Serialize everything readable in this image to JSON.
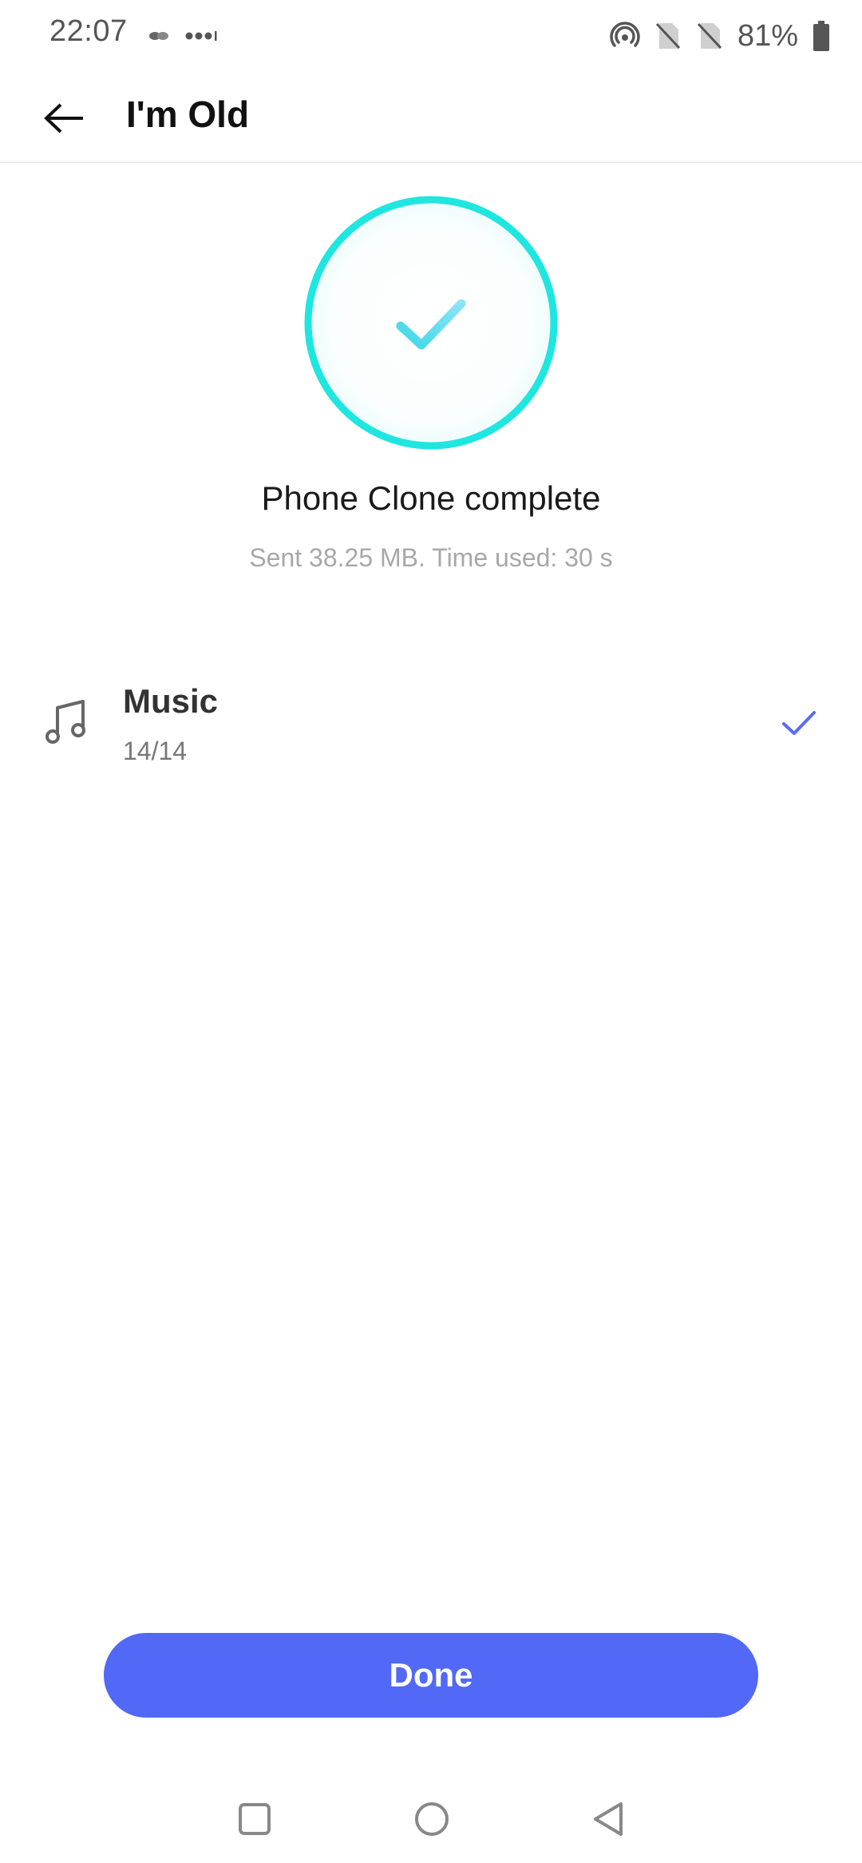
{
  "status_bar": {
    "time": "22:07",
    "battery_percent": "81%",
    "icons": [
      "link-icon",
      "more-dots-icon",
      "hotspot-icon",
      "no-sim-icon",
      "no-sim-icon",
      "battery-icon"
    ]
  },
  "app_bar": {
    "title": "I'm Old",
    "back_icon": "arrow-left-icon"
  },
  "status": {
    "title": "Phone Clone complete",
    "subtitle": "Sent 38.25 MB. Time used: 30 s",
    "icon": "check-circle-icon"
  },
  "items": [
    {
      "icon": "music-note-icon",
      "title": "Music",
      "count": "14/14",
      "status_icon": "check-icon"
    }
  ],
  "actions": {
    "done_label": "Done"
  },
  "nav_bar": {
    "icons": [
      "recent-apps-icon",
      "home-icon",
      "back-triangle-icon"
    ]
  },
  "colors": {
    "accent": "#5169f6",
    "ring": "#1ee6e0",
    "check": "#5a6cf0"
  }
}
